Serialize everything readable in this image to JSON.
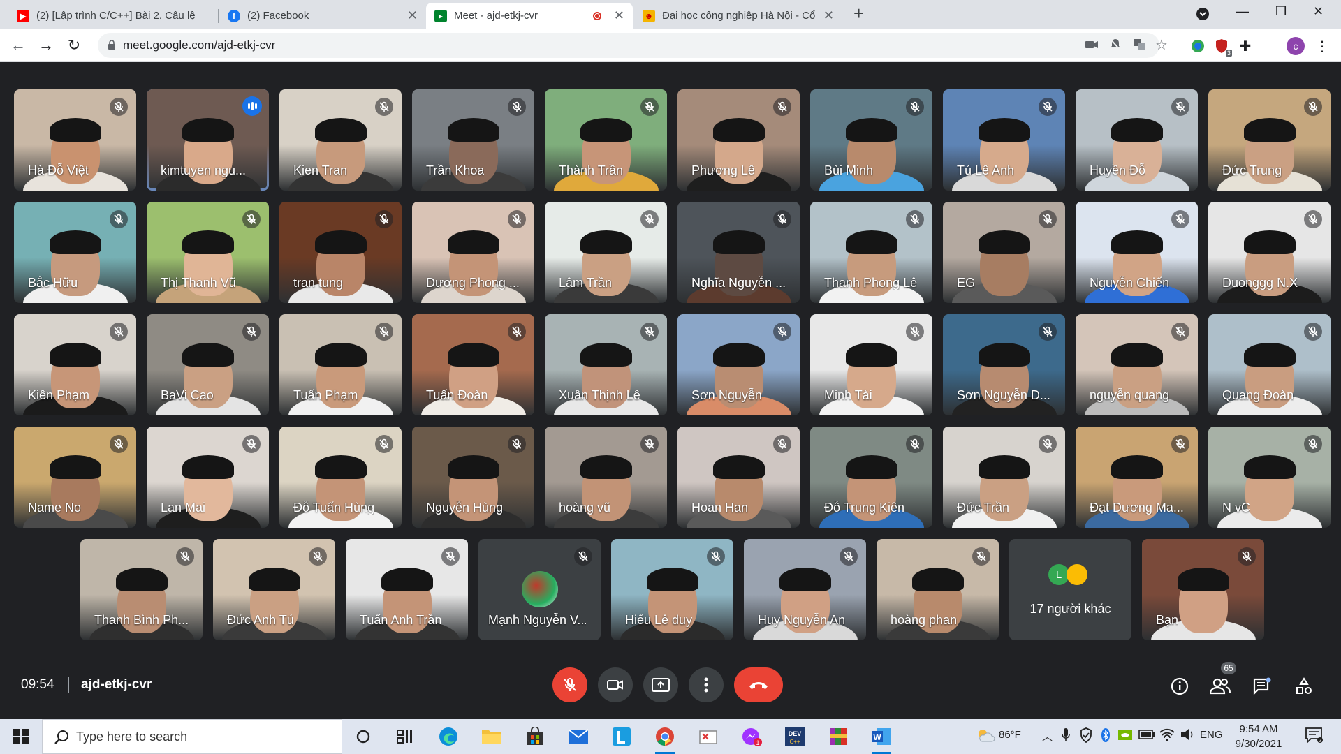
{
  "browser": {
    "tabs": [
      {
        "title": "(2) [Lập trình C/C++] Bài 2. Câu lệ",
        "favicon": "youtube-icon",
        "favicon_color": "#ff0000"
      },
      {
        "title": "(2) Facebook",
        "favicon": "facebook-icon",
        "favicon_color": "#1877f2"
      },
      {
        "title": "Meet - ajd-etkj-cvr",
        "favicon": "google-meet-icon",
        "favicon_color": "#00832d",
        "active": true,
        "recording": true
      },
      {
        "title": "Đại học công nghiệp Hà Nội - Cổ",
        "favicon": "haui-icon",
        "favicon_color": "#f4b400"
      }
    ],
    "url": "meet.google.com/ajd-etkj-cvr",
    "profile_initial": "c",
    "extension_badge": "3"
  },
  "participants": [
    {
      "name": "Hà Đỗ Việt",
      "bg": "#c9b8a6",
      "skin": "#c9926f",
      "shirt": "#e8e3dc"
    },
    {
      "name": "kimtuyen ngu...",
      "bg": "#6e5a52",
      "skin": "#d9a98a",
      "shirt": "#2b2b2b",
      "speaking": true
    },
    {
      "name": "Kien Tran",
      "bg": "#d8d1c6",
      "skin": "#c79a7c",
      "shirt": "#333333"
    },
    {
      "name": "Trần Khoa",
      "bg": "#7a7f84",
      "skin": "#8a6a5a",
      "shirt": "#3b3b3b"
    },
    {
      "name": "Thành Trần",
      "bg": "#7fae7c",
      "skin": "#c79578",
      "shirt": "#e0a93b"
    },
    {
      "name": "Phương Lê",
      "bg": "#a58b7a",
      "skin": "#d4a88b",
      "shirt": "#1e1e1e"
    },
    {
      "name": "Bùi Minh",
      "bg": "#5f7a86",
      "skin": "#b88a6c",
      "shirt": "#4aa3df"
    },
    {
      "name": "Tú Lê Anh",
      "bg": "#5e84b5",
      "skin": "#d6aa8c",
      "shirt": "#d9d9d9"
    },
    {
      "name": "Huyền Đỗ",
      "bg": "#b7c0c6",
      "skin": "#d9b197",
      "shirt": "#cfd6dc"
    },
    {
      "name": "Đức Trung",
      "bg": "#c5a77e",
      "skin": "#caa083",
      "shirt": "#e6e1d6"
    },
    {
      "name": "Bắc Hữu",
      "bg": "#76b0b4",
      "skin": "#c69a7e",
      "shirt": "#f0f0f0"
    },
    {
      "name": "Thị Thanh Vũ",
      "bg": "#9cbf6e",
      "skin": "#e0b596",
      "shirt": "#c5a37a"
    },
    {
      "name": "tran tung",
      "bg": "#6a3a24",
      "skin": "#b98568",
      "shirt": "#e9e9e9"
    },
    {
      "name": "Dương Phong ...",
      "bg": "#d9c3b5",
      "skin": "#c49477",
      "shirt": "#ddd5cd"
    },
    {
      "name": "Lâm Trần",
      "bg": "#e6ebe8",
      "skin": "#caa083",
      "shirt": "#3a3a3a"
    },
    {
      "name": "Nghĩa Nguyễn ...",
      "bg": "#4e545a",
      "skin": "#5d4a42",
      "shirt": "#5c3b2e"
    },
    {
      "name": "Thanh Phong Lê",
      "bg": "#b3c2c9",
      "skin": "#c79b7d",
      "shirt": "#f2f2f2"
    },
    {
      "name": "EG",
      "bg": "#b4a9a0",
      "skin": "#a77d62",
      "shirt": "#5a5a5a"
    },
    {
      "name": "Nguyễn Chiến",
      "bg": "#dce4ef",
      "skin": "#d1a486",
      "shirt": "#2f6fd6"
    },
    {
      "name": "Duonggg N.X",
      "bg": "#e6e6e6",
      "skin": "#c99d80",
      "shirt": "#1c1c1c"
    },
    {
      "name": "Kiên Phạm",
      "bg": "#d8d3cc",
      "skin": "#c79678",
      "shirt": "#1b1b1b"
    },
    {
      "name": "BaVi Cao",
      "bg": "#8f8b84",
      "skin": "#caa083",
      "shirt": "#e4e4e4"
    },
    {
      "name": "Tuấn Phạm",
      "bg": "#c9c0b3",
      "skin": "#c99a7b",
      "shirt": "#f1f1f1"
    },
    {
      "name": "Tuấn Đoàn",
      "bg": "#a56a4e",
      "skin": "#d0a084",
      "shirt": "#f0ece6"
    },
    {
      "name": "Xuân Thịnh Lê",
      "bg": "#a8b3b4",
      "skin": "#c1937a",
      "shirt": "#e8e8e8"
    },
    {
      "name": "Sơn Nguyễn",
      "bg": "#8ba6c8",
      "skin": "#b98d72",
      "shirt": "#d98c68"
    },
    {
      "name": "Minh Tài",
      "bg": "#e8e8e8",
      "skin": "#d6a98b",
      "shirt": "#f2f2f2"
    },
    {
      "name": "Sơn Nguyễn D...",
      "bg": "#3d6a8c",
      "skin": "#b78b70",
      "shirt": "#222222"
    },
    {
      "name": "nguyễn quang",
      "bg": "#d4c5b9",
      "skin": "#caa083",
      "shirt": "#bcbcbc"
    },
    {
      "name": "Quang Đoàn",
      "bg": "#aebfca",
      "skin": "#c99d80",
      "shirt": "#ededed"
    },
    {
      "name": "Name No",
      "bg": "#caa86e",
      "skin": "#a87a5e",
      "shirt": "#4a4a4a"
    },
    {
      "name": "Lan Mai",
      "bg": "#dcd6d0",
      "skin": "#e2b89c",
      "shirt": "#1e1e1e"
    },
    {
      "name": "Đỗ Tuấn Hùng",
      "bg": "#dcd4c3",
      "skin": "#c49477",
      "shirt": "#f2f2f2"
    },
    {
      "name": "Nguyễn Hùng",
      "bg": "#6b5a4a",
      "skin": "#c49477",
      "shirt": "#2d2d2d"
    },
    {
      "name": "hoàng vũ",
      "bg": "#a39a92",
      "skin": "#c29376",
      "shirt": "#3c3c3c"
    },
    {
      "name": "Hoan Han",
      "bg": "#cfc6c2",
      "skin": "#b88a6c",
      "shirt": "#5a5a5a"
    },
    {
      "name": "Đỗ Trung Kiên",
      "bg": "#7f8a84",
      "skin": "#c49477",
      "shirt": "#2e6eb8"
    },
    {
      "name": "Đức Trần",
      "bg": "#d7d3ce",
      "skin": "#caa083",
      "shirt": "#f0f0f0"
    },
    {
      "name": "Đạt Dương Ma...",
      "bg": "#c9a472",
      "skin": "#c99a7b",
      "shirt": "#3b6aa0"
    },
    {
      "name": "N vC",
      "bg": "#a7b1a6",
      "skin": "#d1a486",
      "shirt": "#ebebeb"
    },
    {
      "name": "Thanh Bình Ph...",
      "bg": "#bfb6a9",
      "skin": "#b98d72",
      "shirt": "#2f2f2f"
    },
    {
      "name": "Đức Anh Tú",
      "bg": "#d2c3b0",
      "skin": "#caa083",
      "shirt": "#3a3a3a"
    },
    {
      "name": "Tuấn Anh Trần",
      "bg": "#e7e7e7",
      "skin": "#c49477",
      "shirt": "#333333"
    },
    {
      "name": "Mạnh Nguyễn V...",
      "avatar_only": true
    },
    {
      "name": "Hiếu Lê duy",
      "bg": "#8fb6c4",
      "skin": "#c49477",
      "shirt": "#2b2b2b"
    },
    {
      "name": "Huy Nguyễn An",
      "bg": "#9aa3b0",
      "skin": "#d0a084",
      "shirt": "#d9d9d9"
    },
    {
      "name": "hoàng phan",
      "bg": "#c7b9a8",
      "skin": "#b88a6c",
      "shirt": "#3a3a3a"
    },
    {
      "name": "17 người khác",
      "more": true,
      "avatars": [
        {
          "letter": "L",
          "color": "#34a853"
        },
        {
          "letter": "",
          "color": "#fbbc04"
        }
      ]
    },
    {
      "name": "Bạn",
      "bg": "#7a4a3a",
      "skin": "#d0a084",
      "shirt": "#e6e6e6"
    }
  ],
  "meetbar": {
    "time": "09:54",
    "meeting_code": "ajd-etkj-cvr",
    "participant_count": "65"
  },
  "taskbar": {
    "search_placeholder": "Type here to search",
    "weather": "86°F",
    "language": "ENG",
    "time": "9:54 AM",
    "date": "9/30/2021"
  },
  "colors": {
    "meet_bg": "#202124",
    "hangup": "#ea4335",
    "speaking_outline": "#8ab4f8"
  }
}
